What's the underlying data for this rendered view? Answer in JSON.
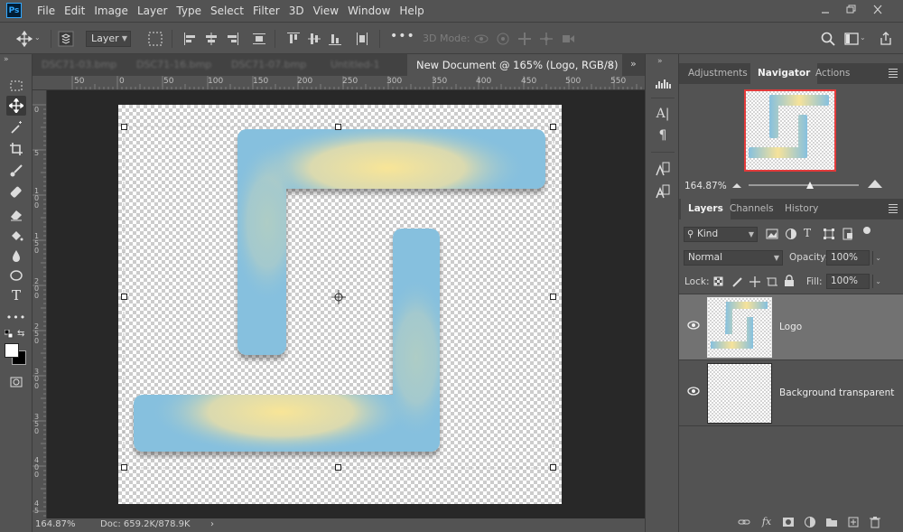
{
  "app": {
    "logo": "Ps"
  },
  "menu": [
    "File",
    "Edit",
    "Image",
    "Layer",
    "Type",
    "Select",
    "Filter",
    "3D",
    "View",
    "Window",
    "Help"
  ],
  "options_bar": {
    "auto_select_target": "Layer",
    "mode_3d_label": "3D Mode:"
  },
  "tabs": {
    "inactive": [
      "DSC71-03.bmp",
      "DSC71-16.bmp",
      "DSC71-07.bmp",
      "Untitled-1"
    ],
    "active": "New Document @ 165% (Logo, RGB/8) *",
    "close": "×",
    "overflow": "»"
  },
  "ruler": {
    "top_labels": [
      "50",
      "0",
      "50",
      "100",
      "150",
      "200",
      "250",
      "300",
      "350",
      "400",
      "450",
      "500",
      "550"
    ],
    "left_labels": [
      "0",
      "5",
      "1 0 0",
      "1 5 0",
      "2 0 0",
      "2 5 0",
      "3 0 0",
      "3 5 0",
      "4 0 0",
      "4 5"
    ]
  },
  "status": {
    "zoom": "164.87%",
    "doc": "Doc: 659.2K/878.9K",
    "arrow": "›"
  },
  "panels": {
    "top_tabs": [
      "Adjustments",
      "Navigator",
      "Actions"
    ],
    "navigator_zoom": "164.87%",
    "layer_tabs": [
      "Layers",
      "Channels",
      "History"
    ],
    "filter_kind": "Kind",
    "blend_mode": "Normal",
    "opacity_label": "Opacity:",
    "opacity_value": "100%",
    "lock_label": "Lock:",
    "fill_label": "Fill:",
    "fill_value": "100%",
    "layers": [
      {
        "name": "Logo",
        "selected": true
      },
      {
        "name": "Background transparent",
        "selected": false
      }
    ],
    "footer_fx": "fx"
  },
  "colors": {
    "logo_blue": "#86c0de",
    "logo_yellow": "#f6e29a",
    "selection_border": "#e23a3a",
    "accent_ps": "#31a8ff"
  }
}
